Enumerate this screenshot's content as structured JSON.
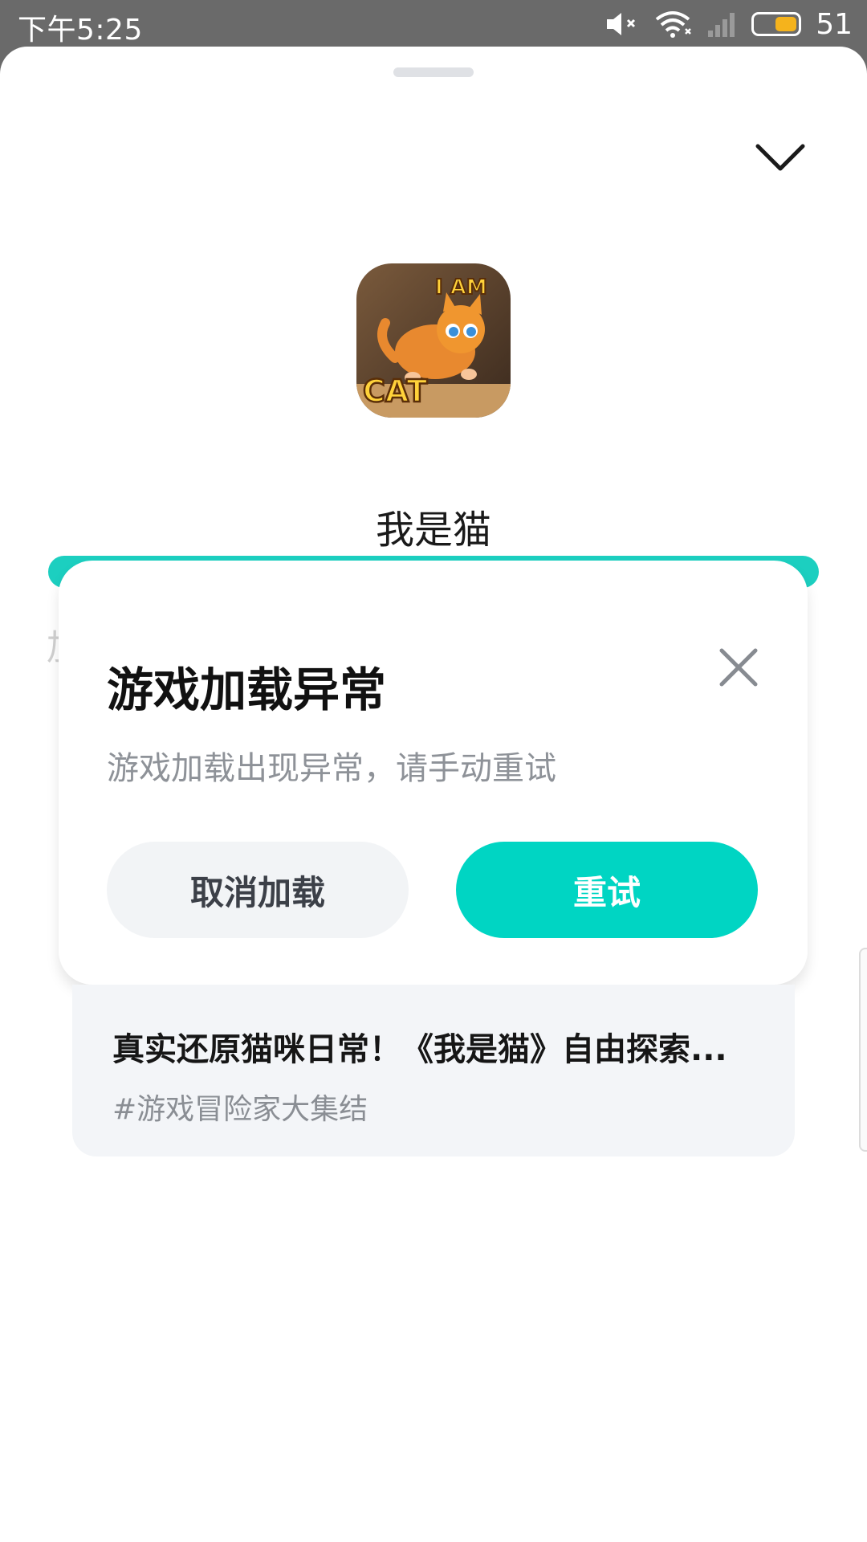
{
  "status_bar": {
    "time": "下午5:25",
    "battery_level": "51",
    "icons": [
      "mute-icon",
      "wifi-icon",
      "signal-icon",
      "battery-icon"
    ]
  },
  "app": {
    "name": "我是猫",
    "icon_text": "I AM CAT"
  },
  "dialog": {
    "title": "游戏加载异常",
    "message": "游戏加载出现异常，请手动重试",
    "cancel_label": "取消加载",
    "retry_label": "重试"
  },
  "topic_card": {
    "title": "真实还原猫咪日常！《我是猫》自由探索...",
    "tag": "#游戏冒险家大集结"
  },
  "colors": {
    "accent": "#00d5c3",
    "status_bar_bg": "#6a6a6a",
    "battery_fill": "#f5b31c"
  }
}
